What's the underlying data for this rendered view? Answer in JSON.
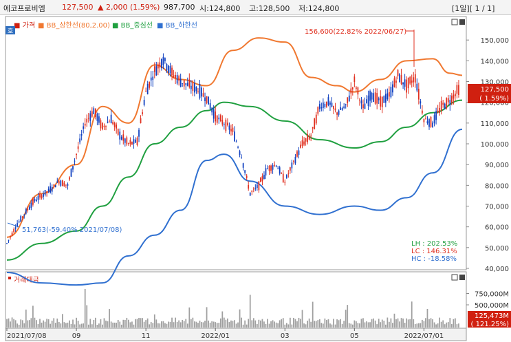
{
  "header": {
    "name": "에코프로비엠",
    "price": "127,500",
    "change": "▲ 2,000 (1.59%)",
    "volume": "987,700",
    "open": "시:124,800",
    "high": "고:128,500",
    "low": "저:124,800",
    "period": "[1일][ 1 / 1]"
  },
  "legend": {
    "price": "가격",
    "upper": "BB_상한선(80,2.00)",
    "middle": "BB_중심선",
    "lower": "BB_하한선"
  },
  "side_box_label": "호",
  "annotations": {
    "max": "156,600(22.82% 2022/06/27)",
    "min": "51,763(-59.40% 2021/07/08)",
    "lh": "LH :  202.53%",
    "lc": "LC :  146.31%",
    "hc": "HC :  -18.58%"
  },
  "price_tag": [
    "127,500",
    "( 1.59%)"
  ],
  "volume_panel": {
    "title": "거래대금"
  },
  "volume_tag": [
    "125,473M",
    "( 121.25%)"
  ],
  "colors": {
    "up": "#e03020",
    "down": "#1040c0",
    "upper_band": "#f07830",
    "middle_band": "#20a040",
    "lower_band": "#3070d0",
    "volume": "#a0a0a0",
    "tag": "#d02010"
  },
  "chart_data": [
    {
      "type": "line",
      "title": "",
      "subtype": "candlestick with Bollinger Bands (80, 2.00)",
      "ylim": [
        40000,
        160000
      ],
      "yticks": [
        "40,000",
        "50,000",
        "60,000",
        "70,000",
        "80,000",
        "90,000",
        "100,000",
        "110,000",
        "120,000",
        "130,000",
        "140,000",
        "150,000"
      ],
      "x_tick_labels": [
        "2021/07/08",
        "09",
        "11",
        "2022/01",
        "03",
        "05",
        "2022/07/01"
      ],
      "x_ticks": [
        0,
        40,
        80,
        120,
        160,
        200,
        240
      ],
      "close_approx": [
        [
          0,
          52000
        ],
        [
          5,
          60000
        ],
        [
          10,
          66000
        ],
        [
          15,
          72000
        ],
        [
          20,
          75000
        ],
        [
          25,
          78000
        ],
        [
          30,
          82000
        ],
        [
          35,
          80000
        ],
        [
          40,
          95000
        ],
        [
          45,
          110000
        ],
        [
          50,
          116000
        ],
        [
          55,
          108000
        ],
        [
          60,
          112000
        ],
        [
          65,
          104000
        ],
        [
          70,
          100000
        ],
        [
          75,
          101000
        ],
        [
          80,
          125000
        ],
        [
          85,
          135000
        ],
        [
          90,
          141000
        ],
        [
          95,
          134000
        ],
        [
          100,
          130000
        ],
        [
          105,
          128000
        ],
        [
          110,
          126000
        ],
        [
          115,
          122000
        ],
        [
          120,
          113000
        ],
        [
          125,
          110000
        ],
        [
          130,
          106000
        ],
        [
          135,
          94000
        ],
        [
          140,
          76000
        ],
        [
          145,
          80000
        ],
        [
          150,
          88000
        ],
        [
          155,
          90000
        ],
        [
          160,
          82000
        ],
        [
          165,
          91000
        ],
        [
          170,
          100000
        ],
        [
          175,
          104000
        ],
        [
          180,
          118000
        ],
        [
          185,
          120000
        ],
        [
          190,
          115000
        ],
        [
          195,
          118000
        ],
        [
          200,
          130000
        ],
        [
          205,
          117000
        ],
        [
          210,
          124000
        ],
        [
          215,
          120000
        ],
        [
          220,
          123000
        ],
        [
          225,
          133000
        ],
        [
          230,
          128000
        ],
        [
          235,
          132000
        ],
        [
          240,
          112000
        ],
        [
          245,
          110000
        ],
        [
          250,
          118000
        ],
        [
          255,
          121000
        ],
        [
          260,
          126500
        ]
      ],
      "series": [
        {
          "values": [
            [
              0,
              55000
            ],
            [
              20,
              76000
            ],
            [
              40,
              90000
            ],
            [
              55,
              118000
            ],
            [
              70,
              110000
            ],
            [
              85,
              138000
            ],
            [
              100,
              131000
            ],
            [
              115,
              128000
            ],
            [
              130,
              145000
            ],
            [
              145,
              151000
            ],
            [
              160,
              149000
            ],
            [
              175,
              132000
            ],
            [
              190,
              128000
            ],
            [
              200,
              125000
            ],
            [
              215,
              131000
            ],
            [
              230,
              140000
            ],
            [
              245,
              141000
            ],
            [
              255,
              134000
            ],
            [
              262,
              133000
            ]
          ]
        },
        {
          "values": [
            [
              0,
              44000
            ],
            [
              20,
              52000
            ],
            [
              40,
              58000
            ],
            [
              55,
              70000
            ],
            [
              70,
              84000
            ],
            [
              85,
              100000
            ],
            [
              100,
              108000
            ],
            [
              115,
              116000
            ],
            [
              125,
              120000
            ],
            [
              140,
              118000
            ],
            [
              160,
              111000
            ],
            [
              180,
              102000
            ],
            [
              200,
              98000
            ],
            [
              215,
              101000
            ],
            [
              230,
              108000
            ],
            [
              245,
              115000
            ],
            [
              262,
              121000
            ]
          ]
        },
        {
          "values": [
            [
              0,
              38000
            ],
            [
              20,
              33000
            ],
            [
              40,
              32000
            ],
            [
              55,
              33000
            ],
            [
              70,
              46000
            ],
            [
              85,
              56000
            ],
            [
              100,
              68000
            ],
            [
              115,
              92000
            ],
            [
              125,
              95000
            ],
            [
              140,
              82000
            ],
            [
              160,
              70000
            ],
            [
              180,
              66000
            ],
            [
              200,
              70000
            ],
            [
              215,
              68000
            ],
            [
              230,
              74000
            ],
            [
              245,
              86000
            ],
            [
              262,
              107000
            ]
          ]
        }
      ]
    },
    {
      "type": "bar",
      "title": "거래대금",
      "subtype": "volume",
      "ylim": [
        0,
        1000000
      ],
      "yticks": [
        "500,000M",
        "750,000M"
      ],
      "x_tick_labels": [
        "2021/07/08",
        "09",
        "11",
        "2022/01",
        "03",
        "05",
        "2022/07/01"
      ],
      "note": "daily trading value; peaks near 850,000M around late Aug 2021"
    }
  ]
}
